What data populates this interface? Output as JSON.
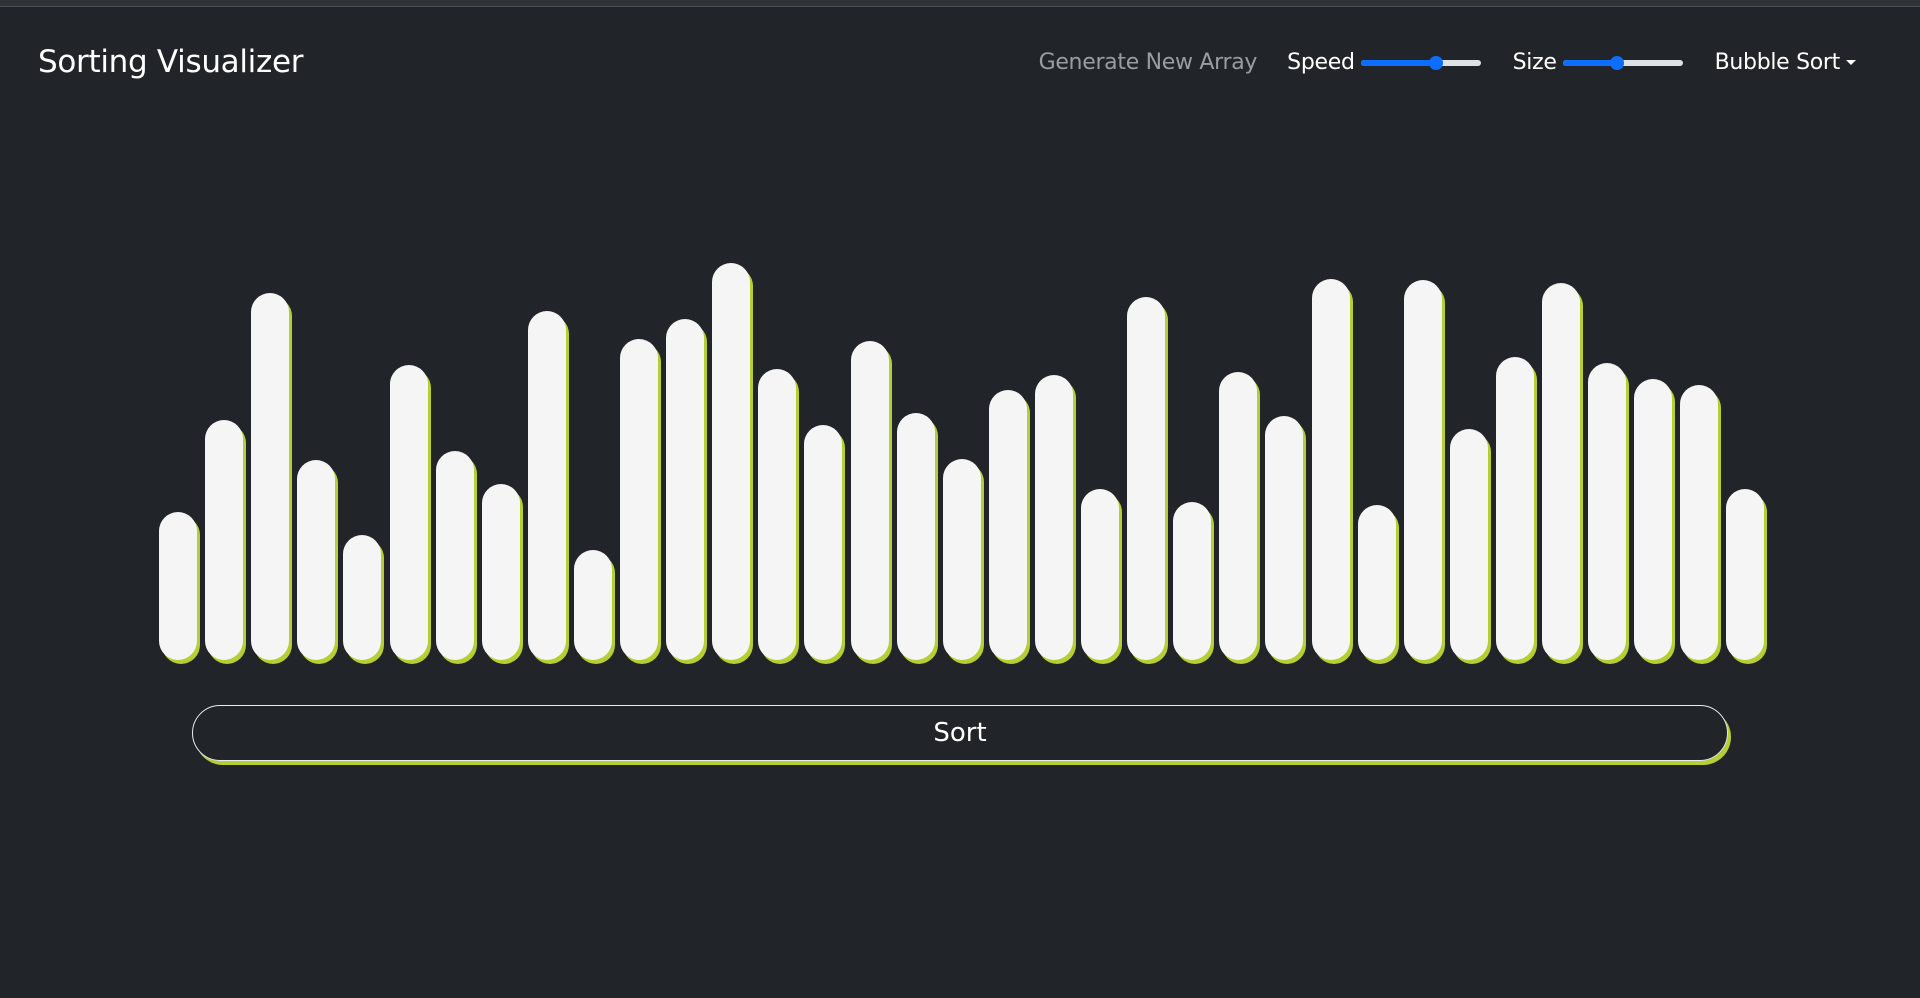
{
  "app": {
    "title": "Sorting Visualizer"
  },
  "nav": {
    "generate_label": "Generate New Array",
    "speed_label": "Speed",
    "speed_value": 0.63,
    "size_label": "Size",
    "size_value": 0.45,
    "algorithm_selected": "Bubble Sort"
  },
  "array": [
    148,
    240,
    367,
    200,
    125,
    295,
    209,
    176,
    349,
    110,
    321,
    341,
    397,
    291,
    235,
    319,
    247,
    201,
    270,
    285,
    171,
    363,
    158,
    288,
    244,
    381,
    155,
    380,
    231,
    303,
    377,
    297,
    281,
    275,
    171
  ],
  "sort_button_label": "Sort",
  "colors": {
    "background": "#212529",
    "bar": "#f5f5f5",
    "accent": "#b5cf32",
    "slider": "#0d6efd"
  }
}
